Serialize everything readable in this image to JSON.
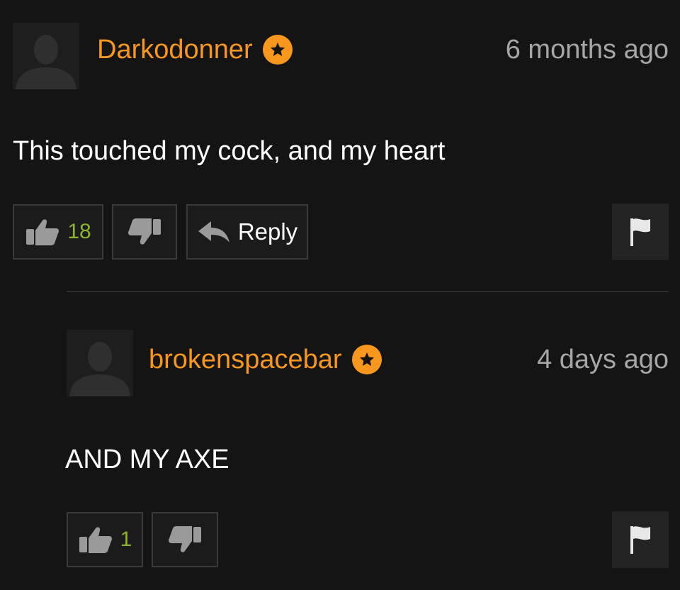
{
  "comments": [
    {
      "username": "Darkodonner",
      "timestamp": "6 months ago",
      "text": "This touched my cock, and my heart",
      "likes": "18",
      "reply_label": "Reply"
    },
    {
      "username": "brokenspacebar",
      "timestamp": "4 days ago",
      "text": "AND MY AXE",
      "likes": "1"
    }
  ],
  "icons": {
    "avatar": "user-silhouette-icon",
    "badge": "star-icon",
    "like": "thumbs-up-icon",
    "dislike": "thumbs-down-icon",
    "reply": "reply-arrow-icon",
    "flag": "flag-icon"
  },
  "colors": {
    "background": "#141414",
    "username": "#f7971d",
    "badge": "#f7971d",
    "timestamp": "#a6a6a6",
    "text": "#ffffff",
    "like_count": "#8cb42e",
    "button_border": "#3a3a3a",
    "icon_gray": "#9a9a9a"
  }
}
